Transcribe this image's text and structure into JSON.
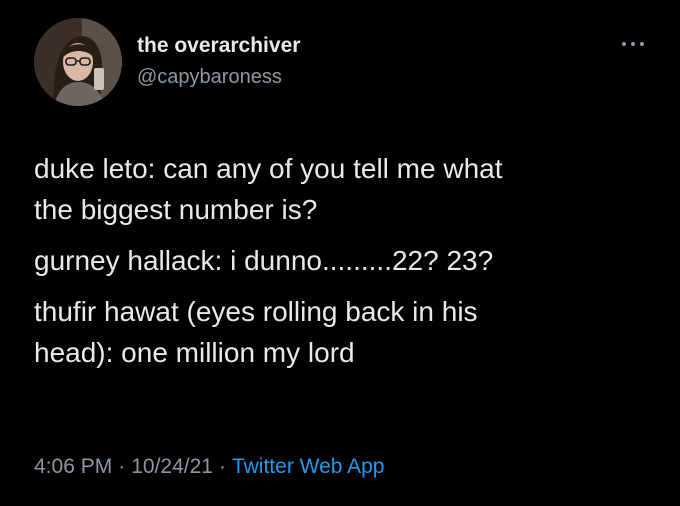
{
  "author": {
    "display_name": "the overarchiver",
    "handle": "@capybaroness"
  },
  "icons": {
    "more": "more-dots-icon",
    "avatar": "profile-photo"
  },
  "tweet": {
    "lines": [
      "duke leto: can any of you tell me what",
      "the biggest number is?",
      "gurney hallack: i dunno.........22? 23?",
      "thufir hawat (eyes rolling back in his",
      "head): one million my lord"
    ]
  },
  "meta": {
    "time": "4:06 PM",
    "separator": "·",
    "date": "10/24/21",
    "source": "Twitter Web App"
  },
  "colors": {
    "background": "#000000",
    "text": "#e7e9ea",
    "secondary": "#8b98a5",
    "link": "#1d9bf0"
  }
}
